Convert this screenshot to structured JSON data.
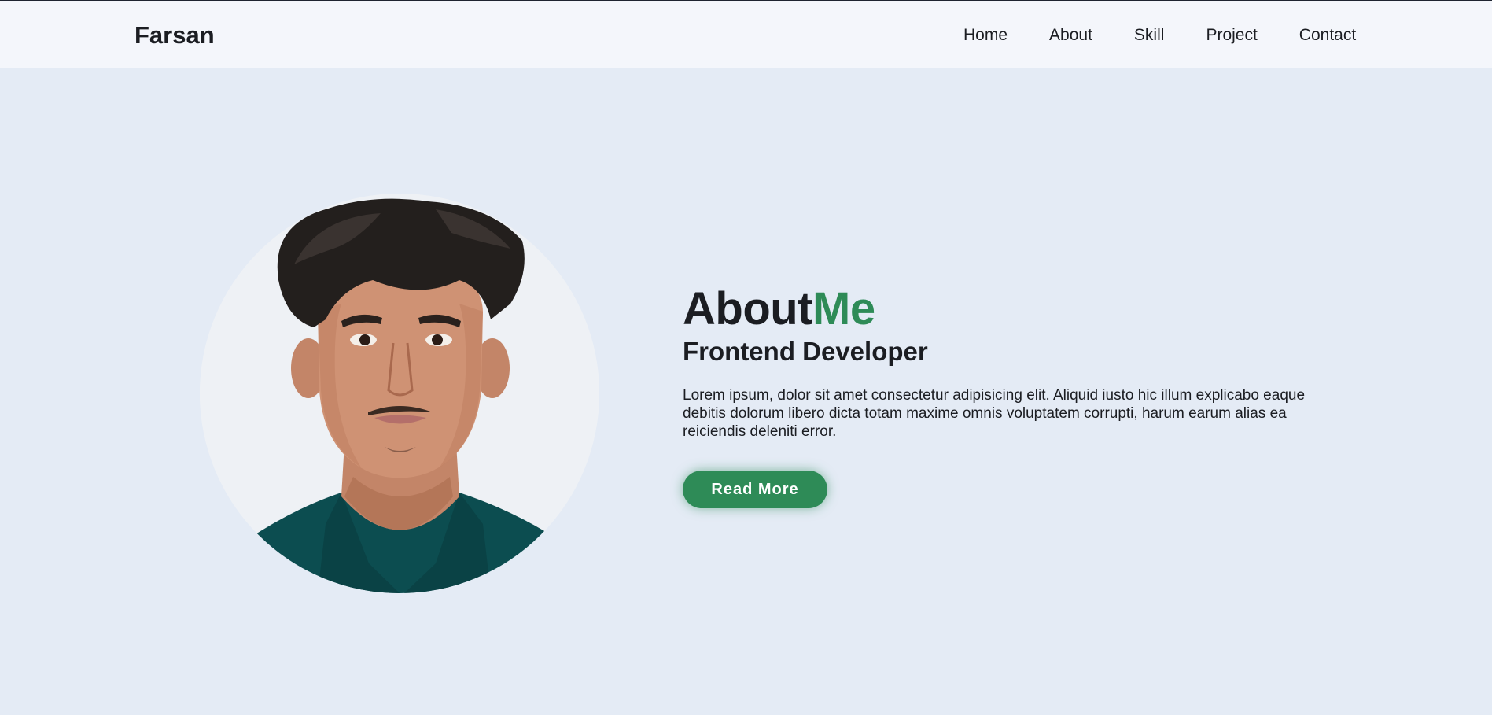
{
  "header": {
    "logo": "Farsan",
    "nav": [
      "Home",
      "About",
      "Skill",
      "Project",
      "Contact"
    ]
  },
  "about": {
    "title_main": "About",
    "title_accent": "Me",
    "subtitle": "Frontend Developer",
    "description": "Lorem ipsum, dolor sit amet consectetur adipisicing elit. Aliquid iusto hic illum explicabo eaque debitis dolorum libero dicta totam maxime omnis voluptatem corrupti, harum earum alias ea reiciendis deleniti error.",
    "button_label": "Read More"
  },
  "colors": {
    "accent": "#2e8b57",
    "background": "#e4ebf5",
    "header_bg": "#f4f6fb",
    "text": "#1b1d22"
  },
  "icons": {
    "profile_photo": "profile-photo"
  }
}
